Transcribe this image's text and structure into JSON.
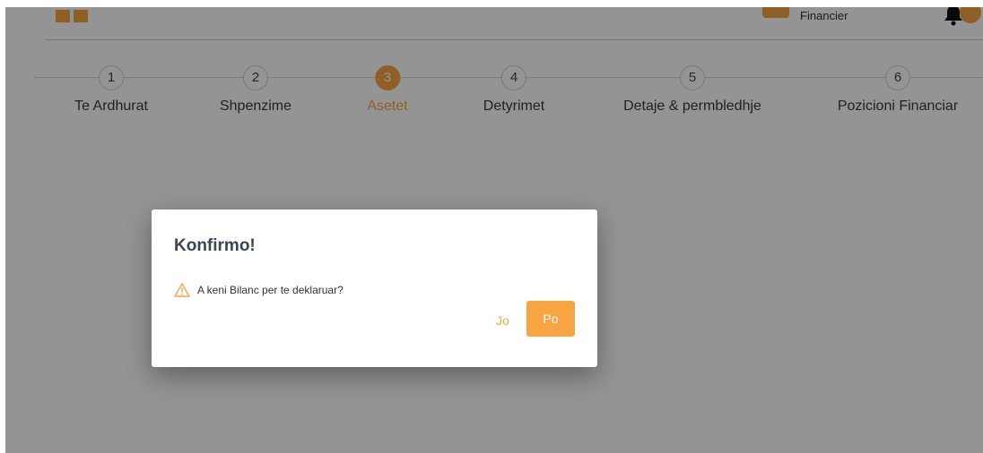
{
  "header": {
    "user_role": "Financier"
  },
  "stepper": {
    "steps": [
      {
        "number": "1",
        "label": "Te Ardhurat",
        "active": false
      },
      {
        "number": "2",
        "label": "Shpenzime",
        "active": false
      },
      {
        "number": "3",
        "label": "Asetet",
        "active": true
      },
      {
        "number": "4",
        "label": "Detyrimet",
        "active": false
      },
      {
        "number": "5",
        "label": "Detaje & permbledhje",
        "active": false
      },
      {
        "number": "6",
        "label": "Pozicioni Financiar",
        "active": false
      }
    ]
  },
  "dialog": {
    "title": "Konfirmo!",
    "icon": "warning-icon",
    "message": "A keni Bilanc per te deklaruar?",
    "cancel_label": "Jo",
    "confirm_label": "Po"
  },
  "colors": {
    "accent": "#f7a543",
    "overlay": "rgba(0,0,0,0.42)"
  }
}
